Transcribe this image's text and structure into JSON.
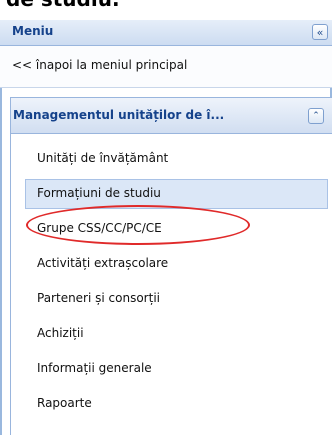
{
  "page_heading_fragment": "de studiu.",
  "panel": {
    "title": "Meniu",
    "collapse_icon": "«",
    "back_link": "<< înapoi la meniul principal"
  },
  "section": {
    "title": "Managementul unităților de î...",
    "expand_icon": "⌃"
  },
  "menu_items": [
    "Unități de învățământ",
    "Formațiuni de studiu",
    "Grupe CSS/CC/PC/CE",
    "Activități extrașcolare",
    "Parteneri și consorții",
    "Achiziții",
    "Informații generale",
    "Rapoarte"
  ],
  "colors": {
    "highlight": "#e02a2a",
    "header_text": "#15428b"
  }
}
